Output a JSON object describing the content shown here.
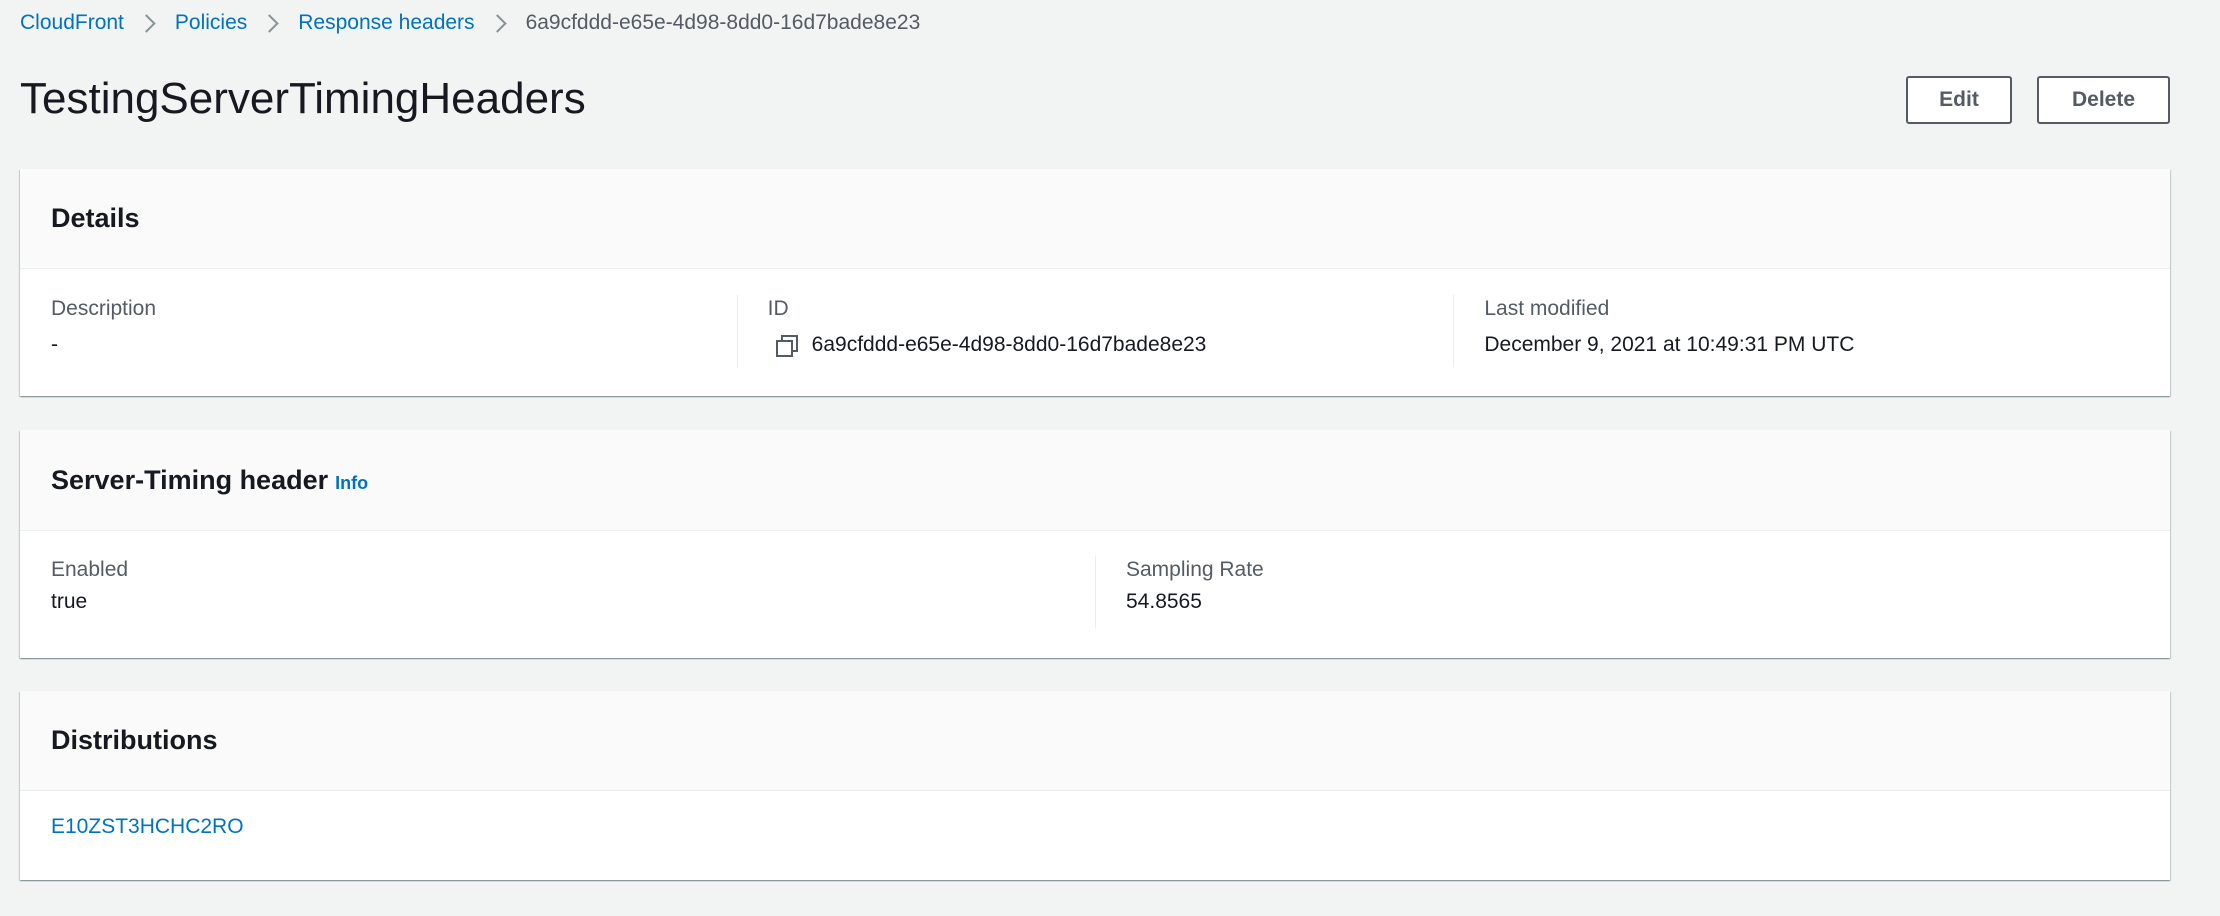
{
  "breadcrumb": {
    "items": [
      {
        "label": "CloudFront"
      },
      {
        "label": "Policies"
      },
      {
        "label": "Response headers"
      }
    ],
    "current": "6a9cfddd-e65e-4d98-8dd0-16d7bade8e23"
  },
  "header": {
    "title": "TestingServerTimingHeaders",
    "edit_label": "Edit",
    "delete_label": "Delete"
  },
  "details": {
    "title": "Details",
    "description": {
      "label": "Description",
      "value": "-"
    },
    "id": {
      "label": "ID",
      "value": "6a9cfddd-e65e-4d98-8dd0-16d7bade8e23",
      "icon": "copy-icon"
    },
    "last_modified": {
      "label": "Last modified",
      "value": "December 9, 2021 at 10:49:31 PM UTC"
    }
  },
  "server_timing": {
    "title": "Server-Timing header",
    "info_label": "Info",
    "enabled": {
      "label": "Enabled",
      "value": "true"
    },
    "sampling_rate": {
      "label": "Sampling Rate",
      "value": "54.8565"
    }
  },
  "distributions": {
    "title": "Distributions",
    "items": [
      {
        "label": "E10ZST3HCHC2RO"
      }
    ]
  },
  "colors": {
    "link": "#0073bb",
    "background": "#f2f3f3",
    "text": "#16191f",
    "secondary_text": "#545b64"
  }
}
